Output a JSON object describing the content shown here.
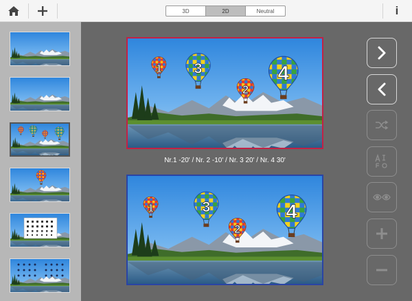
{
  "toolbar": {
    "icons": [
      "home-icon",
      "plus-icon",
      "info-icon"
    ],
    "info_label": "i",
    "modes": [
      {
        "label": "3D",
        "active": false
      },
      {
        "label": "2D",
        "active": true
      },
      {
        "label": "Neutral",
        "active": false
      }
    ]
  },
  "sidebar": {
    "thumbnails": [
      {
        "content": "landscape",
        "selected": false
      },
      {
        "content": "landscape",
        "selected": false
      },
      {
        "content": "balloons",
        "selected": true
      },
      {
        "content": "balloon",
        "selected": false
      },
      {
        "content": "letter-chart",
        "selected": false
      },
      {
        "content": "symbol-chart",
        "selected": false
      }
    ]
  },
  "main": {
    "caption": "Nr.1  -20' / Nr. 2  -10' / Nr. 3  20' / Nr. 4  30'",
    "balloon_numbers": [
      "1",
      "2",
      "3",
      "4"
    ],
    "left_frame_color": "#c32145",
    "right_frame_color": "#2a44a4"
  },
  "controls": {
    "icons": [
      "chevron-right-icon",
      "chevron-left-icon",
      "shuffle-icon",
      "letter-size-icon",
      "eyes-icon",
      "plus-icon",
      "minus-icon"
    ]
  }
}
